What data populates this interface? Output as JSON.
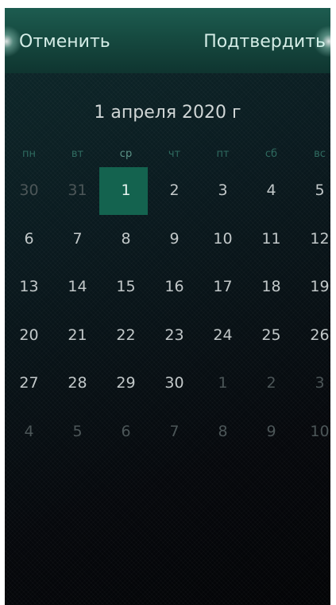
{
  "header": {
    "cancel_label": "Отменить",
    "confirm_label": "Подтвердить"
  },
  "selected_date_label": "1 апреля 2020 г",
  "weekdays": [
    "пн",
    "вт",
    "ср",
    "чт",
    "пт",
    "сб",
    "вс"
  ],
  "current_weekday_index": 2,
  "weeks": [
    [
      {
        "day": "30",
        "in_month": false
      },
      {
        "day": "31",
        "in_month": false
      },
      {
        "day": "1",
        "in_month": true,
        "selected": true
      },
      {
        "day": "2",
        "in_month": true
      },
      {
        "day": "3",
        "in_month": true
      },
      {
        "day": "4",
        "in_month": true
      },
      {
        "day": "5",
        "in_month": true
      }
    ],
    [
      {
        "day": "6",
        "in_month": true
      },
      {
        "day": "7",
        "in_month": true
      },
      {
        "day": "8",
        "in_month": true
      },
      {
        "day": "9",
        "in_month": true
      },
      {
        "day": "10",
        "in_month": true
      },
      {
        "day": "11",
        "in_month": true
      },
      {
        "day": "12",
        "in_month": true
      }
    ],
    [
      {
        "day": "13",
        "in_month": true
      },
      {
        "day": "14",
        "in_month": true
      },
      {
        "day": "15",
        "in_month": true
      },
      {
        "day": "16",
        "in_month": true
      },
      {
        "day": "17",
        "in_month": true
      },
      {
        "day": "18",
        "in_month": true
      },
      {
        "day": "19",
        "in_month": true
      }
    ],
    [
      {
        "day": "20",
        "in_month": true
      },
      {
        "day": "21",
        "in_month": true
      },
      {
        "day": "22",
        "in_month": true
      },
      {
        "day": "23",
        "in_month": true
      },
      {
        "day": "24",
        "in_month": true
      },
      {
        "day": "25",
        "in_month": true
      },
      {
        "day": "26",
        "in_month": true
      }
    ],
    [
      {
        "day": "27",
        "in_month": true
      },
      {
        "day": "28",
        "in_month": true
      },
      {
        "day": "29",
        "in_month": true
      },
      {
        "day": "30",
        "in_month": true
      },
      {
        "day": "1",
        "in_month": false
      },
      {
        "day": "2",
        "in_month": false
      },
      {
        "day": "3",
        "in_month": false
      }
    ],
    [
      {
        "day": "4",
        "in_month": false
      },
      {
        "day": "5",
        "in_month": false
      },
      {
        "day": "6",
        "in_month": false
      },
      {
        "day": "7",
        "in_month": false
      },
      {
        "day": "8",
        "in_month": false
      },
      {
        "day": "9",
        "in_month": false
      },
      {
        "day": "10",
        "in_month": false
      }
    ]
  ],
  "colors": {
    "header_green": "#1d5c50",
    "selected_day_bg": "#14634f",
    "weekday_label": "#2f6b60",
    "background_dark": "#06080c"
  }
}
